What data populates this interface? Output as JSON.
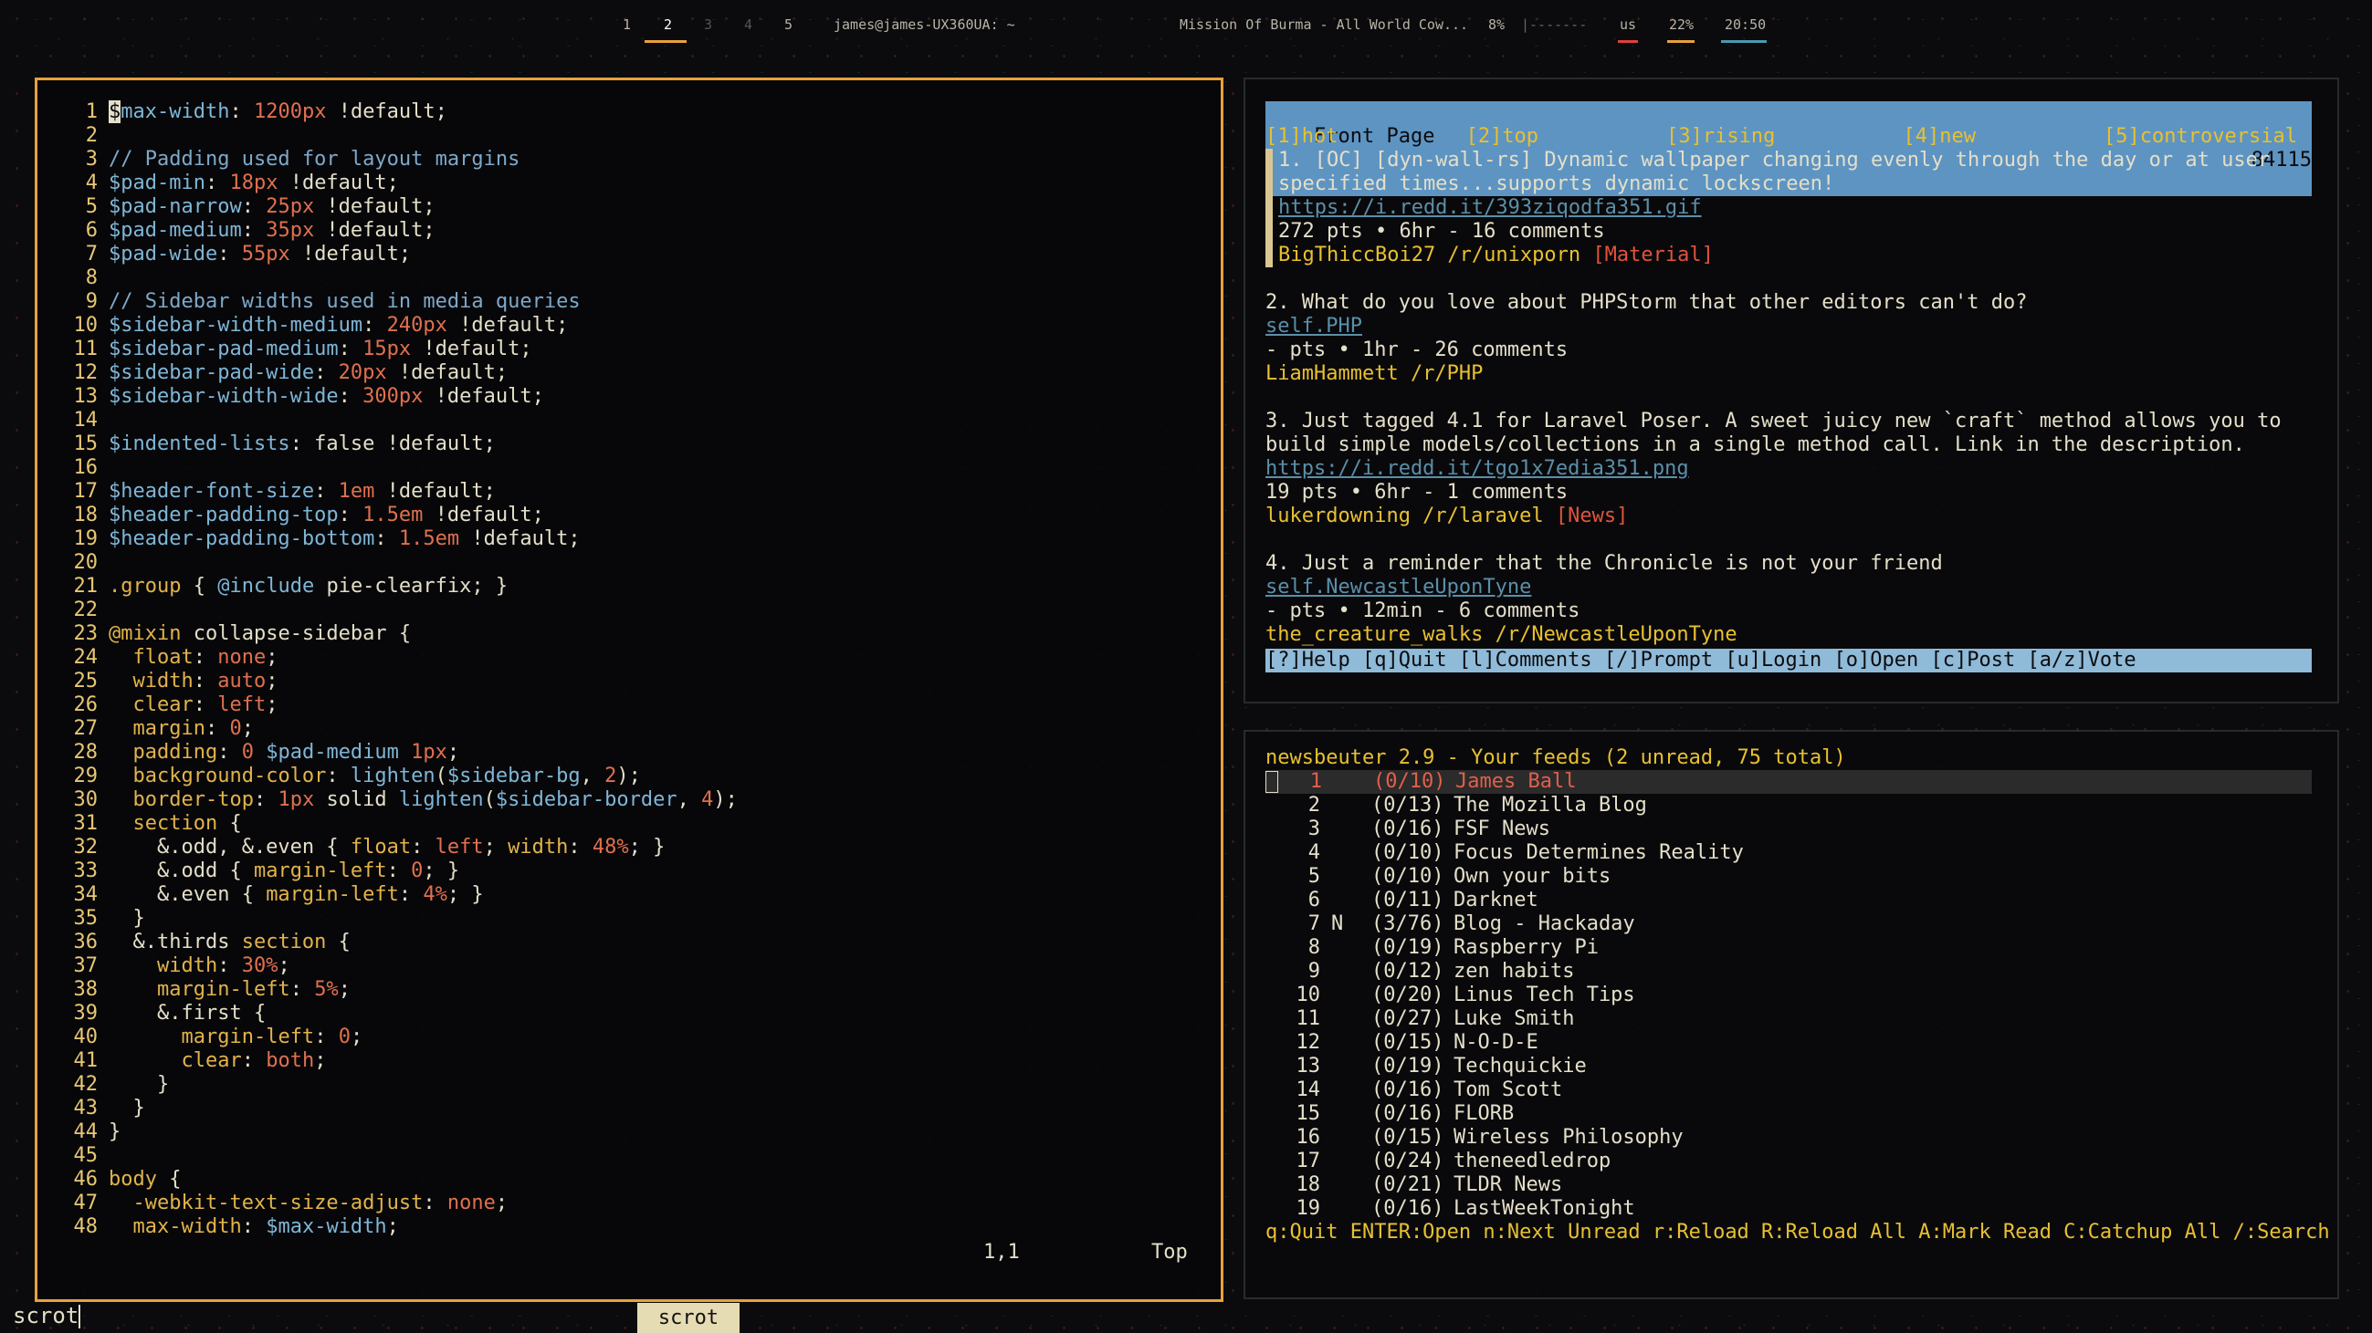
{
  "topbar": {
    "workspaces": [
      "1",
      "2",
      "3",
      "4",
      "5"
    ],
    "active_workspace": "2",
    "window_title": "james@james-UX360UA: ~",
    "media": "Mission Of Burma - All World Cow...",
    "volume": "8%",
    "volume_bar": "|-------",
    "keyboard": "us",
    "battery": "22%",
    "clock": "20:50",
    "colors": {
      "accent": "#e8a13d",
      "kbd": "#e04040",
      "clock": "#4a9ab0"
    }
  },
  "editor": {
    "lines": [
      [
        [
          "cursor",
          "$"
        ],
        [
          "var",
          "max-width"
        ],
        [
          "txt",
          ": "
        ],
        [
          "num",
          "1200px"
        ],
        [
          "txt",
          " !default;"
        ]
      ],
      [],
      [
        [
          "cm",
          "// Padding used for layout margins"
        ]
      ],
      [
        [
          "var",
          "$pad-min"
        ],
        [
          "txt",
          ": "
        ],
        [
          "num",
          "18px"
        ],
        [
          "txt",
          " !default;"
        ]
      ],
      [
        [
          "var",
          "$pad-narrow"
        ],
        [
          "txt",
          ": "
        ],
        [
          "num",
          "25px"
        ],
        [
          "txt",
          " !default;"
        ]
      ],
      [
        [
          "var",
          "$pad-medium"
        ],
        [
          "txt",
          ": "
        ],
        [
          "num",
          "35px"
        ],
        [
          "txt",
          " !default;"
        ]
      ],
      [
        [
          "var",
          "$pad-wide"
        ],
        [
          "txt",
          ": "
        ],
        [
          "num",
          "55px"
        ],
        [
          "txt",
          " !default;"
        ]
      ],
      [],
      [
        [
          "cm",
          "// Sidebar widths used in media queries"
        ]
      ],
      [
        [
          "var",
          "$sidebar-width-medium"
        ],
        [
          "txt",
          ": "
        ],
        [
          "num",
          "240px"
        ],
        [
          "txt",
          " !default;"
        ]
      ],
      [
        [
          "var",
          "$sidebar-pad-medium"
        ],
        [
          "txt",
          ": "
        ],
        [
          "num",
          "15px"
        ],
        [
          "txt",
          " !default;"
        ]
      ],
      [
        [
          "var",
          "$sidebar-pad-wide"
        ],
        [
          "txt",
          ": "
        ],
        [
          "num",
          "20px"
        ],
        [
          "txt",
          " !default;"
        ]
      ],
      [
        [
          "var",
          "$sidebar-width-wide"
        ],
        [
          "txt",
          ": "
        ],
        [
          "num",
          "300px"
        ],
        [
          "txt",
          " !default;"
        ]
      ],
      [],
      [
        [
          "var",
          "$indented-lists"
        ],
        [
          "txt",
          ": false !default;"
        ]
      ],
      [],
      [
        [
          "var",
          "$header-font-size"
        ],
        [
          "txt",
          ": "
        ],
        [
          "num",
          "1em"
        ],
        [
          "txt",
          " !default;"
        ]
      ],
      [
        [
          "var",
          "$header-padding-top"
        ],
        [
          "txt",
          ": "
        ],
        [
          "num",
          "1.5em"
        ],
        [
          "txt",
          " !default;"
        ]
      ],
      [
        [
          "var",
          "$header-padding-bottom"
        ],
        [
          "txt",
          ": "
        ],
        [
          "num",
          "1.5em"
        ],
        [
          "txt",
          " !default;"
        ]
      ],
      [],
      [
        [
          "kw",
          ".group"
        ],
        [
          "txt",
          " { "
        ],
        [
          "var",
          "@include"
        ],
        [
          "txt",
          " pie-clearfix; }"
        ]
      ],
      [],
      [
        [
          "kw",
          "@mixin"
        ],
        [
          "txt",
          " collapse-sidebar {"
        ]
      ],
      [
        [
          "txt",
          "  "
        ],
        [
          "kw",
          "float"
        ],
        [
          "txt",
          ": "
        ],
        [
          "num",
          "none"
        ],
        [
          "txt",
          ";"
        ]
      ],
      [
        [
          "txt",
          "  "
        ],
        [
          "kw",
          "width"
        ],
        [
          "txt",
          ": "
        ],
        [
          "num",
          "auto"
        ],
        [
          "txt",
          ";"
        ]
      ],
      [
        [
          "txt",
          "  "
        ],
        [
          "kw",
          "clear"
        ],
        [
          "txt",
          ": "
        ],
        [
          "num",
          "left"
        ],
        [
          "txt",
          ";"
        ]
      ],
      [
        [
          "txt",
          "  "
        ],
        [
          "kw",
          "margin"
        ],
        [
          "txt",
          ": "
        ],
        [
          "num",
          "0"
        ],
        [
          "txt",
          ";"
        ]
      ],
      [
        [
          "txt",
          "  "
        ],
        [
          "kw",
          "padding"
        ],
        [
          "txt",
          ": "
        ],
        [
          "num",
          "0"
        ],
        [
          "txt",
          " "
        ],
        [
          "var",
          "$pad-medium"
        ],
        [
          "txt",
          " "
        ],
        [
          "num",
          "1px"
        ],
        [
          "txt",
          ";"
        ]
      ],
      [
        [
          "txt",
          "  "
        ],
        [
          "kw",
          "background-color"
        ],
        [
          "txt",
          ": "
        ],
        [
          "var",
          "lighten"
        ],
        [
          "txt",
          "("
        ],
        [
          "var",
          "$sidebar-bg"
        ],
        [
          "txt",
          ", "
        ],
        [
          "num",
          "2"
        ],
        [
          "txt",
          ");"
        ]
      ],
      [
        [
          "txt",
          "  "
        ],
        [
          "kw",
          "border-top"
        ],
        [
          "txt",
          ": "
        ],
        [
          "num",
          "1px"
        ],
        [
          "txt",
          " solid "
        ],
        [
          "var",
          "lighten"
        ],
        [
          "txt",
          "("
        ],
        [
          "var",
          "$sidebar-border"
        ],
        [
          "txt",
          ", "
        ],
        [
          "num",
          "4"
        ],
        [
          "txt",
          ");"
        ]
      ],
      [
        [
          "txt",
          "  "
        ],
        [
          "kw",
          "section"
        ],
        [
          "txt",
          " {"
        ]
      ],
      [
        [
          "txt",
          "    &.odd, &.even { "
        ],
        [
          "kw",
          "float"
        ],
        [
          "txt",
          ": "
        ],
        [
          "num",
          "left"
        ],
        [
          "txt",
          "; "
        ],
        [
          "kw",
          "width"
        ],
        [
          "txt",
          ": "
        ],
        [
          "num",
          "48%"
        ],
        [
          "txt",
          "; }"
        ]
      ],
      [
        [
          "txt",
          "    &.odd { "
        ],
        [
          "kw",
          "margin-left"
        ],
        [
          "txt",
          ": "
        ],
        [
          "num",
          "0"
        ],
        [
          "txt",
          "; }"
        ]
      ],
      [
        [
          "txt",
          "    &.even { "
        ],
        [
          "kw",
          "margin-left"
        ],
        [
          "txt",
          ": "
        ],
        [
          "num",
          "4%"
        ],
        [
          "txt",
          "; }"
        ]
      ],
      [
        [
          "txt",
          "  }"
        ]
      ],
      [
        [
          "txt",
          "  &.thirds "
        ],
        [
          "kw",
          "section"
        ],
        [
          "txt",
          " {"
        ]
      ],
      [
        [
          "txt",
          "    "
        ],
        [
          "kw",
          "width"
        ],
        [
          "txt",
          ": "
        ],
        [
          "num",
          "30%"
        ],
        [
          "txt",
          ";"
        ]
      ],
      [
        [
          "txt",
          "    "
        ],
        [
          "kw",
          "margin-left"
        ],
        [
          "txt",
          ": "
        ],
        [
          "num",
          "5%"
        ],
        [
          "txt",
          ";"
        ]
      ],
      [
        [
          "txt",
          "    &.first {"
        ]
      ],
      [
        [
          "txt",
          "      "
        ],
        [
          "kw",
          "margin-left"
        ],
        [
          "txt",
          ": "
        ],
        [
          "num",
          "0"
        ],
        [
          "txt",
          ";"
        ]
      ],
      [
        [
          "txt",
          "      "
        ],
        [
          "kw",
          "clear"
        ],
        [
          "txt",
          ": "
        ],
        [
          "num",
          "both"
        ],
        [
          "txt",
          ";"
        ]
      ],
      [
        [
          "txt",
          "    }"
        ]
      ],
      [
        [
          "txt",
          "  }"
        ]
      ],
      [
        [
          "txt",
          "}"
        ]
      ],
      [],
      [
        [
          "kw",
          "body"
        ],
        [
          "txt",
          " {"
        ]
      ],
      [
        [
          "txt",
          "  "
        ],
        [
          "kw",
          "-webkit-text-size-adjust"
        ],
        [
          "txt",
          ": "
        ],
        [
          "num",
          "none"
        ],
        [
          "txt",
          ";"
        ]
      ],
      [
        [
          "txt",
          "  "
        ],
        [
          "kw",
          "max-width"
        ],
        [
          "txt",
          ": "
        ],
        [
          "var",
          "$max-width"
        ],
        [
          "txt",
          ";"
        ]
      ]
    ],
    "position": "1,1",
    "scroll": "Top"
  },
  "reddit": {
    "title": "Front Page",
    "karma": "84115",
    "tabs": [
      "[1]hot",
      "[2]top",
      "[3]rising",
      "[4]new",
      "[5]controversial"
    ],
    "posts": [
      {
        "title_lines": [
          "1. [OC] [dyn-wall-rs] Dynamic wallpaper changing evenly through the day or at user",
          "specified times...supports dynamic lockscreen!"
        ],
        "link": "https://i.redd.it/393ziqodfa351.gif",
        "meta": "272 pts • 6hr - 16 comments",
        "user": "BigThiccBoi27",
        "sub": "/r/unixporn",
        "flair": "[Material]",
        "selected": true
      },
      {
        "title_lines": [
          "2. What do you love about PHPStorm that other editors can't do?"
        ],
        "link": "self.PHP",
        "meta": "- pts • 1hr - 26 comments",
        "user": "LiamHammett",
        "sub": "/r/PHP",
        "flair": ""
      },
      {
        "title_lines": [
          "3. Just tagged 4.1 for Laravel Poser. A sweet juicy new `craft` method allows you to",
          "build simple models/collections in a single method call. Link in the description."
        ],
        "link": "https://i.redd.it/tgo1x7edia351.png",
        "meta": "19 pts • 6hr - 1 comments",
        "user": "lukerdowning",
        "sub": "/r/laravel",
        "flair": "[News]"
      },
      {
        "title_lines": [
          "4. Just a reminder that the Chronicle is not your friend"
        ],
        "link": "self.NewcastleUponTyne",
        "meta": "- pts • 12min - 6 comments",
        "user": "the_creature_walks",
        "sub": "/r/NewcastleUponTyne",
        "flair": ""
      }
    ],
    "footer": "[?]Help [q]Quit [l]Comments [/]Prompt [u]Login [o]Open [c]Post [a/z]Vote"
  },
  "newsbeuter": {
    "title": "newsbeuter 2.9 - Your feeds (2 unread, 75 total)",
    "feeds": [
      {
        "idx": "1",
        "flag": "",
        "count": "(0/10)",
        "name": "James Ball"
      },
      {
        "idx": "2",
        "flag": "",
        "count": "(0/13)",
        "name": "The Mozilla Blog"
      },
      {
        "idx": "3",
        "flag": "",
        "count": "(0/16)",
        "name": "FSF News"
      },
      {
        "idx": "4",
        "flag": "",
        "count": "(0/10)",
        "name": "Focus Determines Reality"
      },
      {
        "idx": "5",
        "flag": "",
        "count": "(0/10)",
        "name": "Own your bits"
      },
      {
        "idx": "6",
        "flag": "",
        "count": "(0/11)",
        "name": "Darknet"
      },
      {
        "idx": "7",
        "flag": "N",
        "count": "(3/76)",
        "name": "Blog - Hackaday"
      },
      {
        "idx": "8",
        "flag": "",
        "count": "(0/19)",
        "name": "Raspberry Pi"
      },
      {
        "idx": "9",
        "flag": "",
        "count": "(0/12)",
        "name": "zen habits"
      },
      {
        "idx": "10",
        "flag": "",
        "count": "(0/20)",
        "name": "Linus Tech Tips"
      },
      {
        "idx": "11",
        "flag": "",
        "count": "(0/27)",
        "name": "Luke Smith"
      },
      {
        "idx": "12",
        "flag": "",
        "count": "(0/15)",
        "name": "N-O-D-E"
      },
      {
        "idx": "13",
        "flag": "",
        "count": "(0/19)",
        "name": "Techquickie"
      },
      {
        "idx": "14",
        "flag": "",
        "count": "(0/16)",
        "name": "Tom Scott"
      },
      {
        "idx": "15",
        "flag": "",
        "count": "(0/16)",
        "name": "FLORB"
      },
      {
        "idx": "16",
        "flag": "",
        "count": "(0/15)",
        "name": "Wireless Philosophy"
      },
      {
        "idx": "17",
        "flag": "",
        "count": "(0/24)",
        "name": "theneedledrop"
      },
      {
        "idx": "18",
        "flag": "",
        "count": "(0/21)",
        "name": "TLDR News"
      },
      {
        "idx": "19",
        "flag": "",
        "count": "(0/16)",
        "name": "LastWeekTonight"
      }
    ],
    "selected_index": 0,
    "footer": "q:Quit ENTER:Open n:Next Unread r:Reload R:Reload All A:Mark Read C:Catchup All /:Search"
  },
  "bottom": {
    "command": "scrot",
    "task": "scrot"
  }
}
